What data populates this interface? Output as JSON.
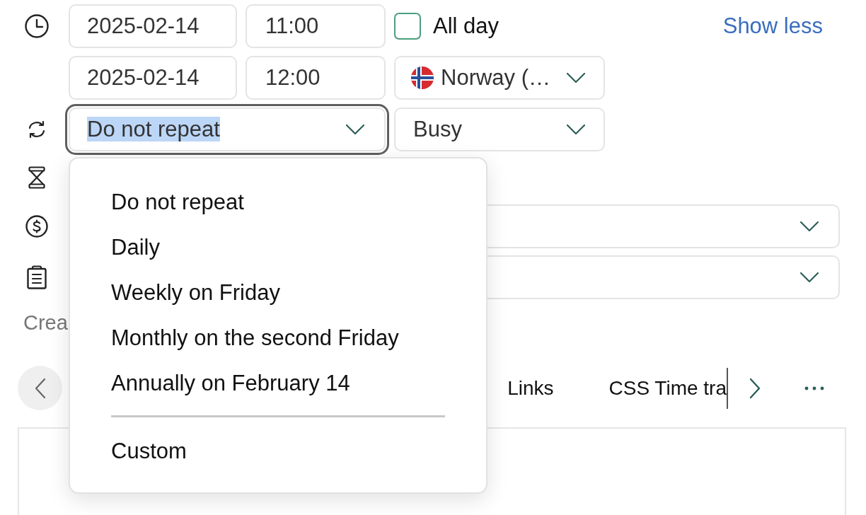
{
  "start": {
    "date": "2025-02-14",
    "time": "11:00"
  },
  "all_day": {
    "label": "All day",
    "checked": false
  },
  "show_less_link": "Show less",
  "end": {
    "date": "2025-02-14",
    "time": "12:00"
  },
  "timezone_select": {
    "value": "Norway (…"
  },
  "repeat_select": {
    "value": "Do not repeat",
    "focused": true,
    "expanded": true,
    "options": [
      {
        "kind": "option",
        "label": "Do not repeat"
      },
      {
        "kind": "option",
        "label": "Daily"
      },
      {
        "kind": "option",
        "label": "Weekly on Friday"
      },
      {
        "kind": "option",
        "label": "Monthly on the second Friday"
      },
      {
        "kind": "option",
        "label": "Annually on February 14"
      },
      {
        "kind": "divider"
      },
      {
        "kind": "option",
        "label": "Custom"
      }
    ]
  },
  "availability_select": {
    "value": "Busy"
  },
  "create_text": "Crea",
  "tabs": [
    {
      "label": "Links"
    },
    {
      "label": "CSS Time tra"
    }
  ]
}
